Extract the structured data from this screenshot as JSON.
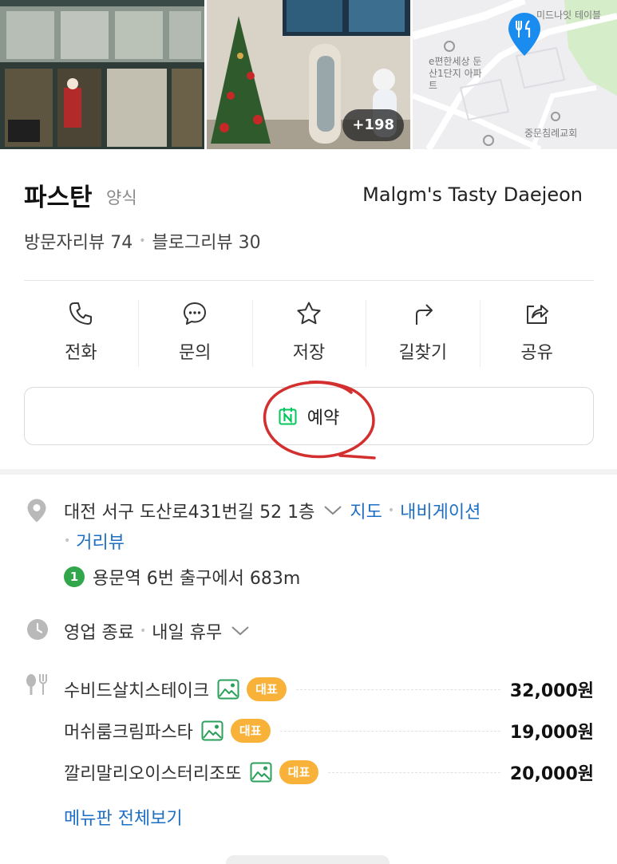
{
  "photos": {
    "more_count": "+198",
    "map_labels": [
      "미드나잇 테이블",
      "e편한세상 둔산1단지 아파트",
      "중문침례교회"
    ]
  },
  "place": {
    "name": "파스탄",
    "category": "양식",
    "brand": "Malgm's Tasty Daejeon"
  },
  "reviews": {
    "visitor": "방문자리뷰 74",
    "blog": "블로그리뷰 30"
  },
  "actions": [
    {
      "label": "전화",
      "icon": "phone-icon"
    },
    {
      "label": "문의",
      "icon": "chat-icon"
    },
    {
      "label": "저장",
      "icon": "star-icon"
    },
    {
      "label": "길찾기",
      "icon": "directions-icon"
    },
    {
      "label": "공유",
      "icon": "share-icon"
    }
  ],
  "reserve": {
    "label": "예약",
    "icon": "naver-calendar-icon"
  },
  "address": {
    "text": "대전 서구 도산로431번길 52 1층",
    "links": [
      "지도",
      "내비게이션",
      "거리뷰"
    ]
  },
  "subway": {
    "line": "1",
    "text": "용문역 6번 출구에서 683m"
  },
  "hours": {
    "status": "영업 종료",
    "next": "내일 휴무"
  },
  "menu": {
    "items": [
      {
        "name": "수비드살치스테이크",
        "badge": "대표",
        "price": "32,000원"
      },
      {
        "name": "머쉬룸크림파스타",
        "badge": "대표",
        "price": "19,000원"
      },
      {
        "name": "깔리말리오이스터리조또",
        "badge": "대표",
        "price": "20,000원"
      }
    ],
    "view_all": "메뉴판 전체보기"
  },
  "colors": {
    "link": "#1e6fc4",
    "badge": "#f8b239",
    "subway_line1": "#31a64a",
    "naver_green": "#03c75a",
    "map_pin": "#1a8cf0",
    "annotation_red": "#d32f2f"
  }
}
